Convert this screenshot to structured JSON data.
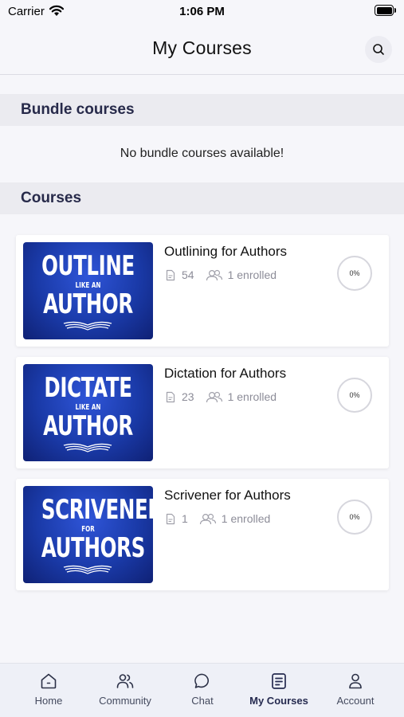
{
  "status_bar": {
    "carrier": "Carrier",
    "time": "1:06 PM"
  },
  "header": {
    "title": "My Courses",
    "search_icon": "search-icon"
  },
  "bundle_section": {
    "title": "Bundle courses",
    "empty_message": "No bundle courses available!"
  },
  "courses_section": {
    "title": "Courses",
    "items": [
      {
        "title": "Outlining for Authors",
        "lessons": "54",
        "enrolled": "1 enrolled",
        "progress": "0%",
        "thumb_top": "OUTLINE",
        "thumb_mid": "LIKE AN",
        "thumb_bottom": "AUTHOR"
      },
      {
        "title": "Dictation for Authors",
        "lessons": "23",
        "enrolled": "1 enrolled",
        "progress": "0%",
        "thumb_top": "DICTATE",
        "thumb_mid": "LIKE AN",
        "thumb_bottom": "AUTHOR"
      },
      {
        "title": "Scrivener for Authors",
        "lessons": "1",
        "enrolled": "1 enrolled",
        "progress": "0%",
        "thumb_top": "SCRIVENER",
        "thumb_mid": "FOR",
        "thumb_bottom": "AUTHORS"
      }
    ]
  },
  "tab_bar": {
    "active": "My Courses",
    "tabs": [
      {
        "label": "Home",
        "icon": "home-icon"
      },
      {
        "label": "Community",
        "icon": "community-icon"
      },
      {
        "label": "Chat",
        "icon": "chat-icon"
      },
      {
        "label": "My Courses",
        "icon": "my-courses-icon"
      },
      {
        "label": "Account",
        "icon": "account-icon"
      }
    ]
  },
  "colors": {
    "background": "#f6f6fa",
    "section_header": "#ebebf0",
    "section_text": "#272a4a",
    "thumb_blue": "#1a3aa8",
    "tab_bar": "#eef0f7"
  }
}
